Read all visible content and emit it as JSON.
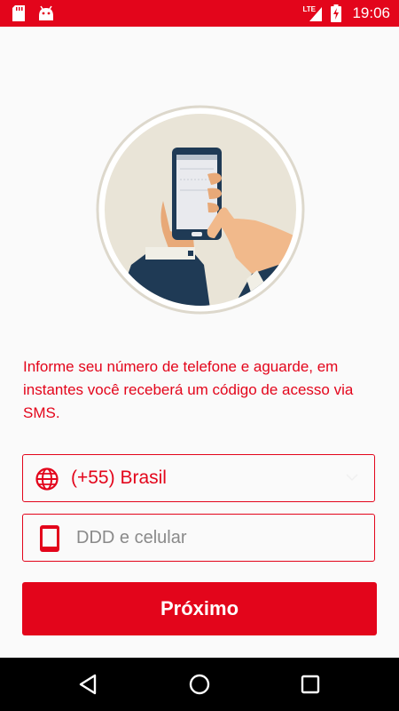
{
  "status_bar": {
    "time": "19:06",
    "network": "LTE",
    "background_color": "#e3051b"
  },
  "illustration": {
    "icon": "hand-holding-phone-illustration"
  },
  "instructions": {
    "text": "Informe seu número de telefone e aguarde, em instantes você receberá um código de acesso via SMS."
  },
  "country_field": {
    "icon": "globe-icon",
    "value": "(+55) Brasil"
  },
  "phone_field": {
    "icon": "mobile-phone-icon",
    "placeholder": "DDD e celular",
    "value": ""
  },
  "next_button": {
    "label": "Próximo"
  },
  "nav_bar": {
    "back_icon": "back-triangle-icon",
    "home_icon": "home-circle-icon",
    "recent_icon": "recent-apps-square-icon"
  },
  "colors": {
    "accent": "#e3051b",
    "background": "#fafafa",
    "nav": "#000000"
  }
}
